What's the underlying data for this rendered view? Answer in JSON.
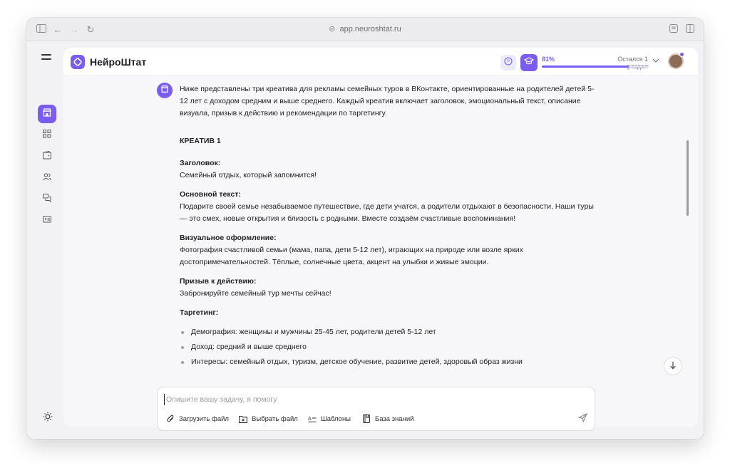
{
  "browser": {
    "url": "app.neuroshtat.ru"
  },
  "header": {
    "brand": "НейроШтат",
    "progress_percent_label": "81%",
    "progress_value": 0.81,
    "progress_note": "Остался 1 раздел"
  },
  "chat": {
    "intro": "Ниже представлены три креатива для рекламы семейных туров в ВКонтакте, ориентированные на родителей детей 5-12 лет с доходом средним и выше среднего. Каждый креатив включает заголовок, эмоциональный текст, описание визуала, призыв к действию и рекомендации по таргетингу.",
    "creative_title": "КРЕАТИВ 1",
    "headline_label": "Заголовок:",
    "headline_text": "Семейный отдых, который запомнится!",
    "body_label": "Основной текст:",
    "body_text": "Подарите своей семье незабываемое путешествие, где дети учатся, а родители отдыхают в безопасности. Наши туры — это смех, новые открытия и близость с родными. Вместе создаём счастливые воспоминания!",
    "visual_label": "Визуальное оформление:",
    "visual_text": "Фотография счастливой семьи (мама, папа, дети 5-12 лет), играющих на природе или возле ярких достопримечательностей. Тёплые, солнечные цвета, акцент на улыбки и живые эмоции.",
    "cta_label": "Призыв к действию:",
    "cta_text": "Забронируйте семейный тур мечты сейчас!",
    "targeting_label": "Таргетинг:",
    "targeting_items": [
      "Демография: женщины и мужчины 25-45 лет, родители детей 5-12 лет",
      "Доход: средний и выше среднего",
      "Интересы: семейный отдых, туризм, детское обучение, развитие детей, здоровый образ жизни"
    ]
  },
  "composer": {
    "placeholder": "Опишите вашу задачу, я помогу",
    "upload_label": "Загрузить файл",
    "choose_label": "Выбрать файл",
    "templates_label": "Шаблоны",
    "knowledge_label": "База знаний"
  },
  "colors": {
    "accent": "#7b5cf0",
    "background": "#f2f2f4",
    "panel": "#f7f7f9"
  }
}
